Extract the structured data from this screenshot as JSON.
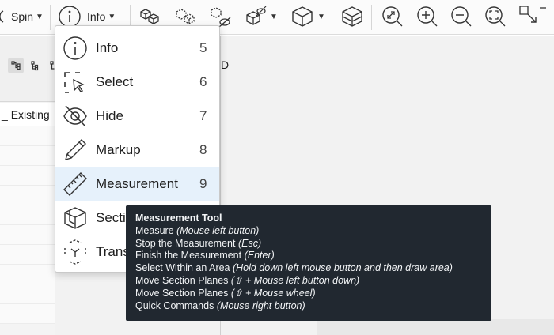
{
  "toolbar": {
    "spin_label": "Spin",
    "info_label": "Info",
    "icons": [
      "spin-icon",
      "info-icon",
      "model-cubes-icon",
      "dashed-cubes-icon",
      "hide-cubes-icon",
      "transparency-icon",
      "view-cube-icon",
      "section-box-icon",
      "zoom-extents-icon",
      "zoom-in-icon",
      "zoom-out-icon",
      "zoom-fit-icon",
      "select-area-icon"
    ]
  },
  "left_panel": {
    "column_header": "Existing"
  },
  "viewport": {
    "tab_label": "D"
  },
  "dropdown": {
    "items": [
      {
        "label": "Info",
        "shortcut": "5",
        "icon": "info-icon"
      },
      {
        "label": "Select",
        "shortcut": "6",
        "icon": "select-icon"
      },
      {
        "label": "Hide",
        "shortcut": "7",
        "icon": "hide-icon"
      },
      {
        "label": "Markup",
        "shortcut": "8",
        "icon": "markup-pencil-icon"
      },
      {
        "label": "Measurement",
        "shortcut": "9",
        "icon": "ruler-icon"
      },
      {
        "label": "Secti",
        "shortcut": "",
        "icon": "section-cube-icon"
      },
      {
        "label": "Trans",
        "shortcut": "",
        "icon": "transform-icon"
      }
    ],
    "highlighted_index": 4
  },
  "tooltip": {
    "title": "Measurement Tool",
    "lines": [
      {
        "text": "Measure ",
        "hint": "(Mouse left button)"
      },
      {
        "text": "Stop the Measurement ",
        "hint": "(Esc)"
      },
      {
        "text": "Finish the Measurement ",
        "hint": "(Enter)"
      },
      {
        "text": "Select Within an Area ",
        "hint": "(Hold down left mouse button and then draw area)"
      },
      {
        "text": "Move Section Planes ",
        "hint": "(⇧ + Mouse left button down)"
      },
      {
        "text": "Move Section Planes ",
        "hint": "(⇧ + Mouse wheel)"
      },
      {
        "text": "Quick Commands ",
        "hint": "(Mouse right button)"
      }
    ]
  },
  "colors": {
    "tooltip_bg": "#212830",
    "highlight": "#e6f1fb",
    "toolbar_bg": "#fbfbfb"
  }
}
